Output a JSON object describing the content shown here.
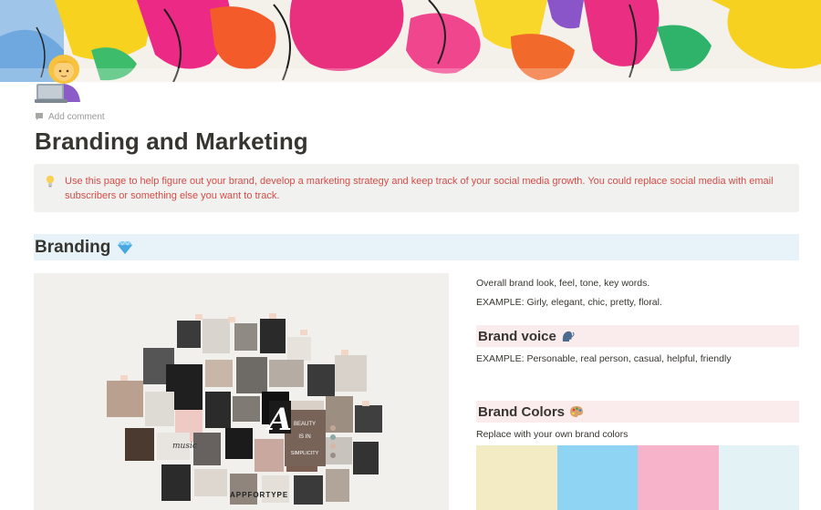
{
  "page": {
    "add_comment_label": "Add comment",
    "title": "Branding and Marketing",
    "callout_text": "Use this page to help figure out your brand, develop a marketing strategy and keep track of your social media growth. You could replace social media with email subscribers or something else you want to track."
  },
  "icons": {
    "page_icon": "woman-technologist-icon",
    "comment": "comment-icon",
    "callout": "lightbulb-icon",
    "branding": "gem-icon",
    "brand_voice": "speaking-head-icon",
    "brand_colors": "artist-palette-icon"
  },
  "branding": {
    "heading": "Branding",
    "overall_text": "Overall brand look, feel, tone, key words.",
    "example_text": "EXAMPLE: Girly, elegant, chic, pretty, floral.",
    "moodboard_caption_1": "BEAUTY",
    "moodboard_caption_2": "IS IN",
    "moodboard_caption_3": "SIMPLICITY",
    "moodboard_caption_4": "APPFORTYPE",
    "moodboard_caption_5": "music",
    "moodboard_caption_6": "A"
  },
  "brand_voice": {
    "heading": "Brand voice",
    "example_text": "EXAMPLE: Personable, real person, casual, helpful, friendly"
  },
  "brand_colors": {
    "heading": "Brand Colors",
    "description": "Replace with your own brand colors",
    "swatches": [
      "#f3ebc3",
      "#8fd5f3",
      "#f7b3c9",
      "#e3f3f5"
    ]
  },
  "colors": {
    "callout_text": "#d44c47",
    "callout_bg": "#f1f1ef",
    "branding_heading_bg": "#e7f3f8",
    "sub_heading_bg": "#faecec"
  }
}
